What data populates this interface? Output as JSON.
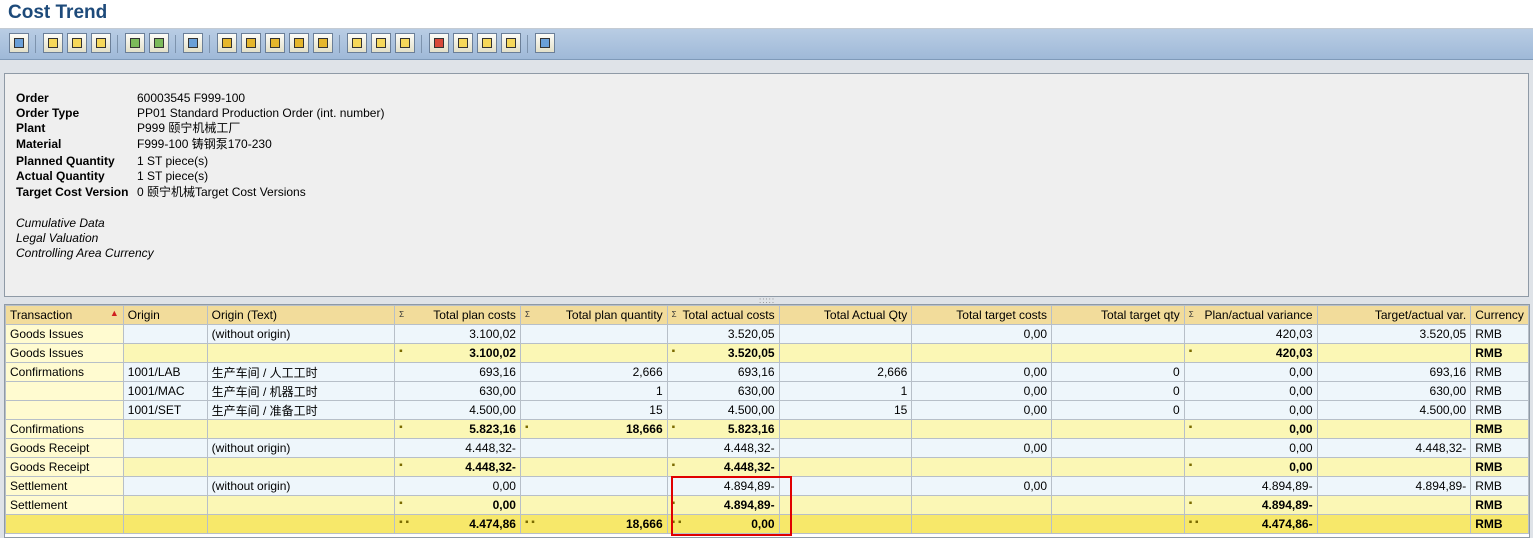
{
  "window": {
    "title": "Cost Trend"
  },
  "header": {
    "fields": [
      {
        "label": "Order",
        "value": "60003545 F999-100"
      },
      {
        "label": "Order Type",
        "value": "PP01 Standard Production Order (int. number)"
      },
      {
        "label": "Plant",
        "value": "P999 颐宁机械工厂"
      },
      {
        "label": "Material",
        "value": "F999-100 铸钢泵170-230"
      },
      {
        "label": "Planned Quantity",
        "value": "1 ST piece(s)"
      },
      {
        "label": "Actual Quantity",
        "value": "1 ST piece(s)"
      },
      {
        "label": "Target Cost Version",
        "value": "0 颐宁机械Target Cost Versions"
      }
    ],
    "notes": [
      "Cumulative Data",
      "Legal Valuation",
      "Controlling Area Currency"
    ]
  },
  "grid": {
    "columns": [
      "Transaction",
      "Origin",
      "Origin (Text)",
      "Total plan costs",
      "Total plan quantity",
      "Total actual costs",
      "Total Actual Qty",
      "Total target costs",
      "Total target qty",
      "Plan/actual variance",
      "Target/actual var.",
      "Currency"
    ],
    "rows": [
      {
        "type": "data",
        "cells": [
          "Goods Issues",
          "",
          "(without origin)",
          "3.100,02",
          "",
          "3.520,05",
          "",
          "0,00",
          "",
          "420,03",
          "3.520,05",
          "RMB"
        ]
      },
      {
        "type": "sum",
        "cells": [
          "Goods Issues",
          "",
          "",
          "3.100,02",
          "",
          "3.520,05",
          "",
          "",
          "",
          "420,03",
          "",
          "RMB"
        ]
      },
      {
        "type": "data",
        "cells": [
          "Confirmations",
          "1001/LAB",
          "生产车间 / 人工工时",
          "693,16",
          "2,666",
          "693,16",
          "2,666",
          "0,00",
          "0",
          "0,00",
          "693,16",
          "RMB"
        ]
      },
      {
        "type": "data",
        "cells": [
          "",
          "1001/MAC",
          "生产车间 / 机器工时",
          "630,00",
          "1",
          "630,00",
          "1",
          "0,00",
          "0",
          "0,00",
          "630,00",
          "RMB"
        ]
      },
      {
        "type": "data",
        "cells": [
          "",
          "1001/SET",
          "生产车间 / 准备工时",
          "4.500,00",
          "15",
          "4.500,00",
          "15",
          "0,00",
          "0",
          "0,00",
          "4.500,00",
          "RMB"
        ]
      },
      {
        "type": "sum",
        "cells": [
          "Confirmations",
          "",
          "",
          "5.823,16",
          "18,666",
          "5.823,16",
          "",
          "",
          "",
          "0,00",
          "",
          "RMB"
        ]
      },
      {
        "type": "data",
        "cells": [
          "Goods Receipt",
          "",
          "(without origin)",
          "4.448,32-",
          "",
          "4.448,32-",
          "",
          "0,00",
          "",
          "0,00",
          "4.448,32-",
          "RMB"
        ]
      },
      {
        "type": "sum",
        "cells": [
          "Goods Receipt",
          "",
          "",
          "4.448,32-",
          "",
          "4.448,32-",
          "",
          "",
          "",
          "0,00",
          "",
          "RMB"
        ]
      },
      {
        "type": "data",
        "cells": [
          "Settlement",
          "",
          "(without origin)",
          "0,00",
          "",
          "4.894,89-",
          "",
          "0,00",
          "",
          "4.894,89-",
          "4.894,89-",
          "RMB"
        ]
      },
      {
        "type": "sum",
        "cells": [
          "Settlement",
          "",
          "",
          "0,00",
          "",
          "4.894,89-",
          "",
          "",
          "",
          "4.894,89-",
          "",
          "RMB"
        ]
      },
      {
        "type": "total",
        "cells": [
          "",
          "",
          "",
          "4.474,86",
          "18,666",
          "0,00",
          "",
          "",
          "",
          "4.474,86-",
          "",
          "RMB"
        ]
      }
    ]
  },
  "colors": {
    "header_bg": "#f2dc9b",
    "total_row": "#f7e86a",
    "subtotal_row": "#fbf7b5",
    "highlight_box": "#e00000"
  }
}
